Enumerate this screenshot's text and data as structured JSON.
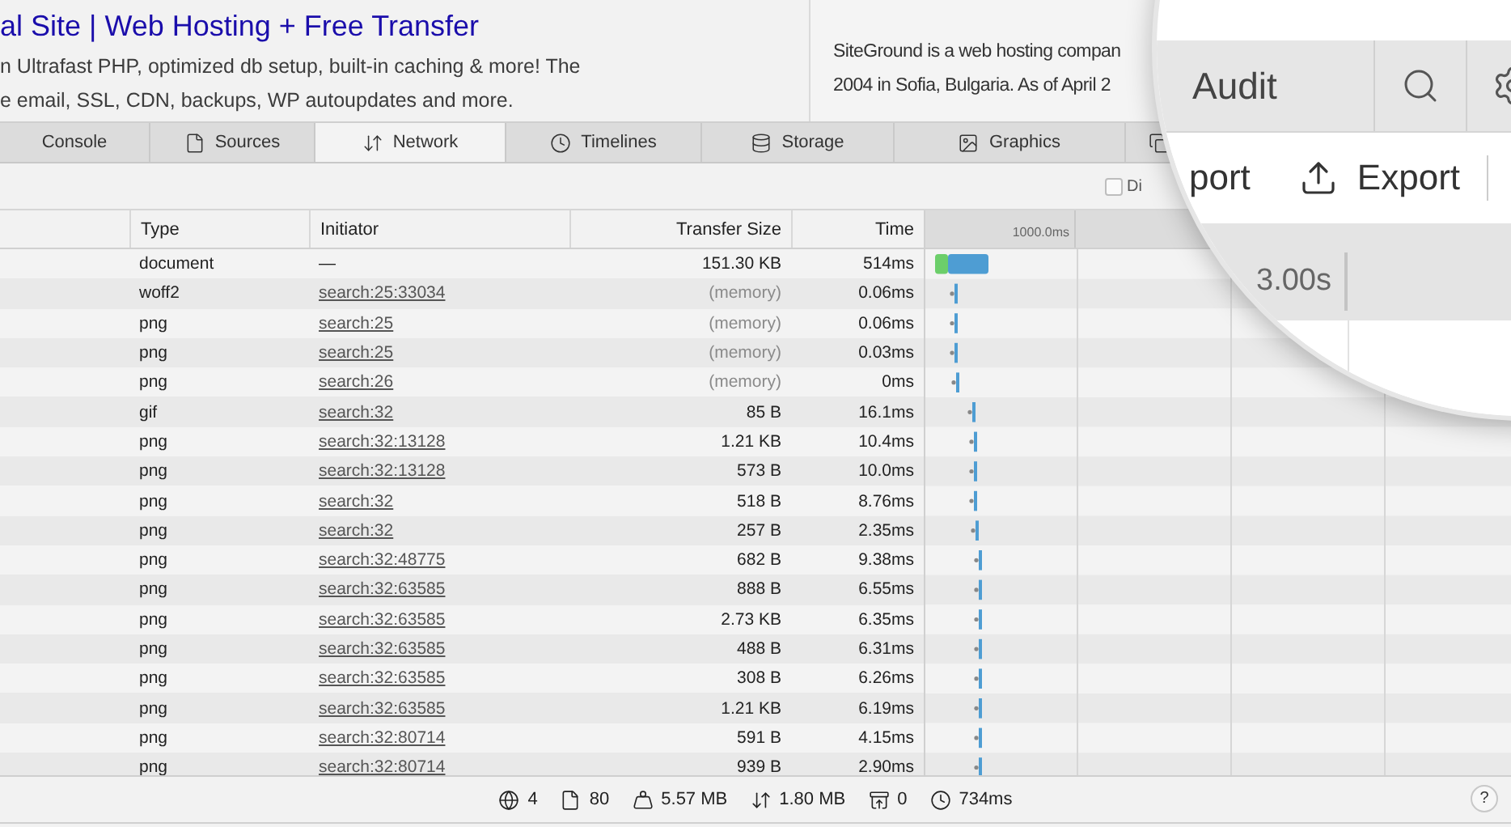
{
  "search_result": {
    "title": "al Site | Web Hosting + Free Transfer",
    "snippet_lines": [
      "n Ultrafast PHP, optimized db setup, built-in caching & more! The",
      "e email, SSL, CDN, backups, WP autoupdates and more."
    ]
  },
  "knowledge_panel": {
    "lines": [
      "SiteGround is a web hosting compan",
      "2004 in Sofia, Bulgaria. As of April 2"
    ]
  },
  "devtools": {
    "tabs": [
      {
        "label": "Console",
        "kind": "console",
        "selected": false
      },
      {
        "label": "Sources",
        "kind": "sources",
        "selected": false
      },
      {
        "label": "Network",
        "kind": "network",
        "selected": true
      },
      {
        "label": "Timelines",
        "kind": "timelines",
        "selected": false
      },
      {
        "label": "Storage",
        "kind": "storage",
        "selected": false
      },
      {
        "label": "Graphics",
        "kind": "graphics",
        "selected": false
      }
    ],
    "toolbar": {
      "checkbox": {
        "label": "Di",
        "checked": false
      }
    },
    "table": {
      "columns": [
        "Type",
        "Initiator",
        "Transfer Size",
        "Time"
      ],
      "waterfall_tick": "1000.0ms",
      "rows": [
        {
          "type": "document",
          "initiator": "—",
          "linked": false,
          "size": "151.30 KB",
          "from_cache": false,
          "time": "514ms"
        },
        {
          "type": "woff2",
          "initiator": "search:25:33034",
          "linked": true,
          "size": "(memory)",
          "from_cache": true,
          "time": "0.06ms"
        },
        {
          "type": "png",
          "initiator": "search:25",
          "linked": true,
          "size": "(memory)",
          "from_cache": true,
          "time": "0.06ms"
        },
        {
          "type": "png",
          "initiator": "search:25",
          "linked": true,
          "size": "(memory)",
          "from_cache": true,
          "time": "0.03ms"
        },
        {
          "type": "png",
          "initiator": "search:26",
          "linked": true,
          "size": "(memory)",
          "from_cache": true,
          "time": "0ms"
        },
        {
          "type": "gif",
          "initiator": "search:32",
          "linked": true,
          "size": "85 B",
          "from_cache": false,
          "time": "16.1ms"
        },
        {
          "type": "png",
          "initiator": "search:32:13128",
          "linked": true,
          "size": "1.21 KB",
          "from_cache": false,
          "time": "10.4ms"
        },
        {
          "type": "png",
          "initiator": "search:32:13128",
          "linked": true,
          "size": "573 B",
          "from_cache": false,
          "time": "10.0ms"
        },
        {
          "type": "png",
          "initiator": "search:32",
          "linked": true,
          "size": "518 B",
          "from_cache": false,
          "time": "8.76ms"
        },
        {
          "type": "png",
          "initiator": "search:32",
          "linked": true,
          "size": "257 B",
          "from_cache": false,
          "time": "2.35ms"
        },
        {
          "type": "png",
          "initiator": "search:32:48775",
          "linked": true,
          "size": "682 B",
          "from_cache": false,
          "time": "9.38ms"
        },
        {
          "type": "png",
          "initiator": "search:32:63585",
          "linked": true,
          "size": "888 B",
          "from_cache": false,
          "time": "6.55ms"
        },
        {
          "type": "png",
          "initiator": "search:32:63585",
          "linked": true,
          "size": "2.73 KB",
          "from_cache": false,
          "time": "6.35ms"
        },
        {
          "type": "png",
          "initiator": "search:32:63585",
          "linked": true,
          "size": "488 B",
          "from_cache": false,
          "time": "6.31ms"
        },
        {
          "type": "png",
          "initiator": "search:32:63585",
          "linked": true,
          "size": "308 B",
          "from_cache": false,
          "time": "6.26ms"
        },
        {
          "type": "png",
          "initiator": "search:32:63585",
          "linked": true,
          "size": "1.21 KB",
          "from_cache": false,
          "time": "6.19ms"
        },
        {
          "type": "png",
          "initiator": "search:32:80714",
          "linked": true,
          "size": "591 B",
          "from_cache": false,
          "time": "4.15ms"
        },
        {
          "type": "png",
          "initiator": "search:32:80714",
          "linked": true,
          "size": "939 B",
          "from_cache": false,
          "time": "2.90ms"
        }
      ]
    },
    "status_bar": {
      "items": [
        {
          "kind": "domains",
          "text": "4"
        },
        {
          "kind": "resources",
          "text": "80"
        },
        {
          "kind": "size",
          "text": "5.57 MB"
        },
        {
          "kind": "transferred",
          "text": "1.80 MB"
        },
        {
          "kind": "cached",
          "text": "0"
        },
        {
          "kind": "duration",
          "text": "734ms"
        }
      ],
      "help": "?"
    }
  },
  "magnifier": {
    "tab": "Audit",
    "buttons": [
      {
        "label": "port",
        "kind": "plain"
      },
      {
        "label": "Export",
        "kind": "export"
      }
    ],
    "timeline_tick": "3.00s"
  }
}
